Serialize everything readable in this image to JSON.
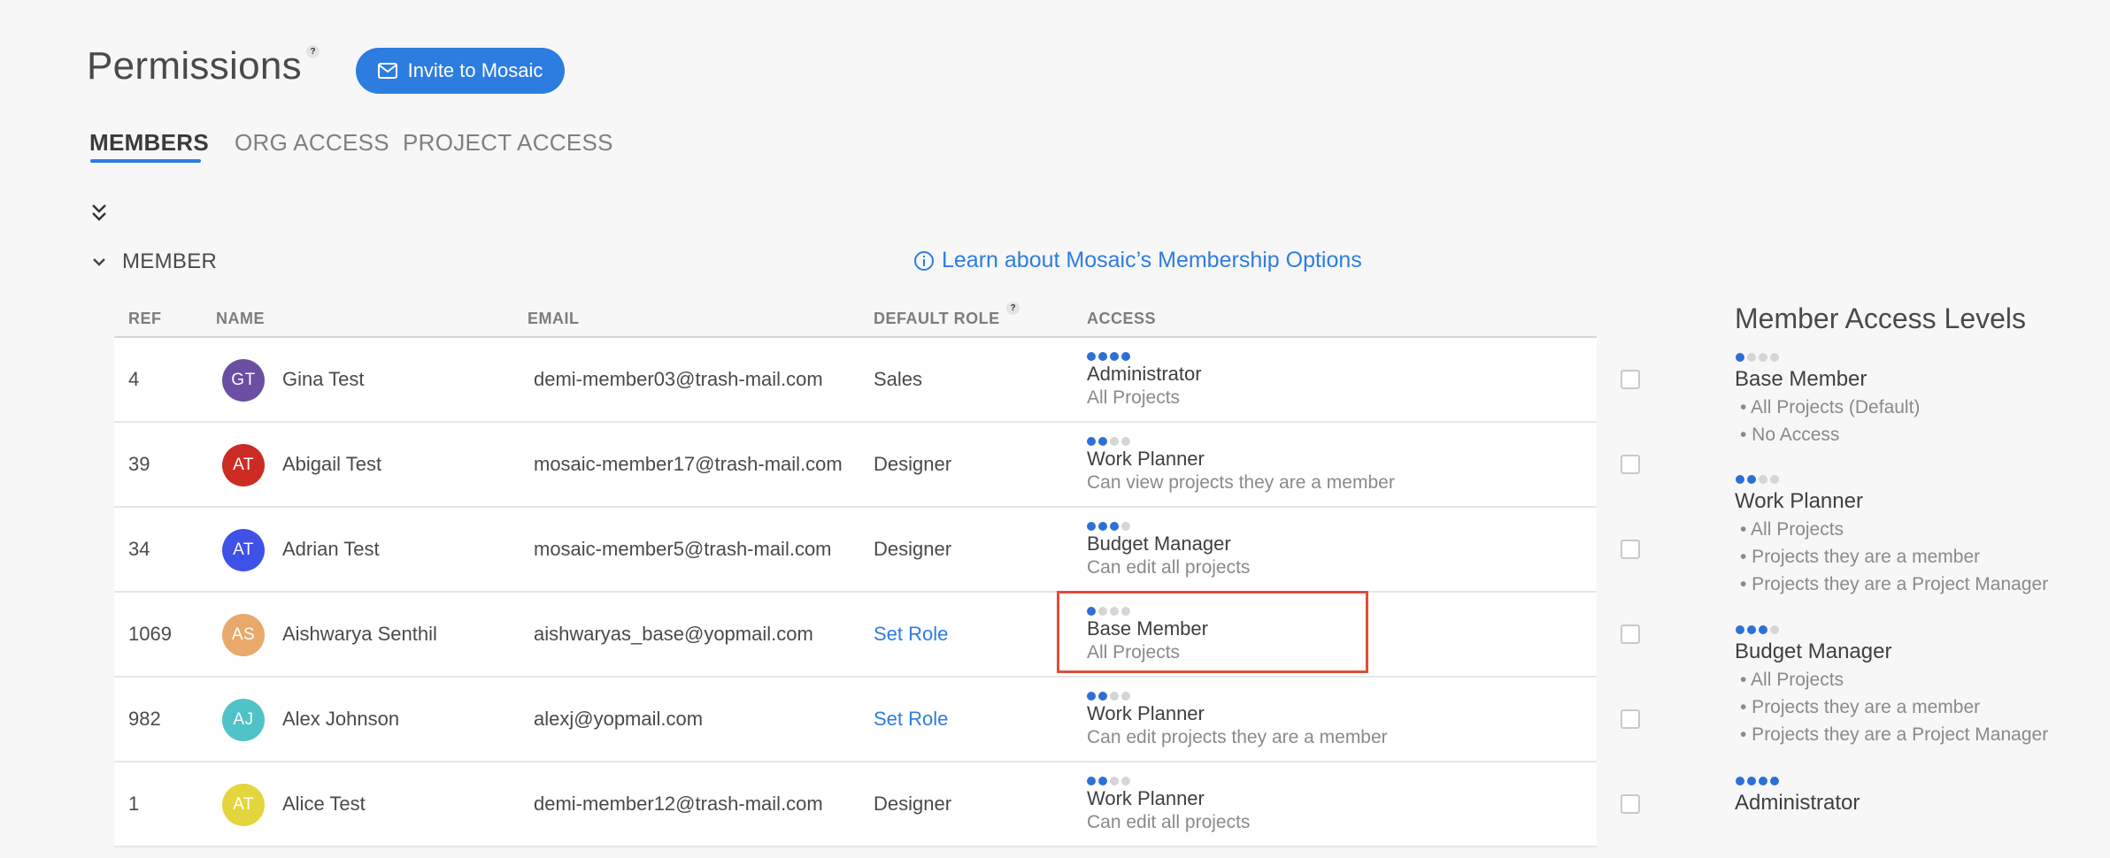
{
  "header": {
    "title": "Permissions",
    "help_symbol": "?",
    "invite_label": "Invite to Mosaic"
  },
  "tabs": [
    {
      "label": "MEMBERS",
      "active": true
    },
    {
      "label": "ORG ACCESS",
      "active": false
    },
    {
      "label": "PROJECT ACCESS",
      "active": false
    }
  ],
  "section": {
    "title": "MEMBER",
    "learn_link": "Learn about Mosaic’s Membership Options"
  },
  "table": {
    "columns": [
      "REF",
      "NAME",
      "EMAIL",
      "DEFAULT ROLE",
      "ACCESS"
    ],
    "rows": [
      {
        "ref": "4",
        "initials": "GT",
        "avatar_color": "#6a4fa3",
        "name": "Gina Test",
        "email": "demi-member03@trash-mail.com",
        "role": "Sales",
        "role_is_link": false,
        "level": 4,
        "access": "Administrator",
        "access_sub": "All Projects"
      },
      {
        "ref": "39",
        "initials": "AT",
        "avatar_color": "#cc2b24",
        "name": "Abigail Test",
        "email": "mosaic-member17@trash-mail.com",
        "role": "Designer",
        "role_is_link": false,
        "level": 2,
        "access": "Work Planner",
        "access_sub": "Can view projects they are a member"
      },
      {
        "ref": "34",
        "initials": "AT",
        "avatar_color": "#3f51e6",
        "name": "Adrian Test",
        "email": "mosaic-member5@trash-mail.com",
        "role": "Designer",
        "role_is_link": false,
        "level": 3,
        "access": "Budget Manager",
        "access_sub": "Can edit all projects"
      },
      {
        "ref": "1069",
        "initials": "AS",
        "avatar_color": "#e8a96b",
        "name": "Aishwarya Senthil",
        "email": "aishwaryas_base@yopmail.com",
        "role": "Set Role",
        "role_is_link": true,
        "level": 1,
        "access": "Base Member",
        "access_sub": "All Projects"
      },
      {
        "ref": "982",
        "initials": "AJ",
        "avatar_color": "#4fc3c7",
        "name": "Alex Johnson",
        "email": "alexj@yopmail.com",
        "role": "Set Role",
        "role_is_link": true,
        "level": 2,
        "access": "Work Planner",
        "access_sub": "Can edit projects they are a member"
      },
      {
        "ref": "1",
        "initials": "AT",
        "avatar_color": "#e3d63c",
        "name": "Alice Test",
        "email": "demi-member12@trash-mail.com",
        "role": "Designer",
        "role_is_link": false,
        "level": 2,
        "access": "Work Planner",
        "access_sub": "Can edit all projects"
      }
    ]
  },
  "sidebar": {
    "title": "Member Access Levels",
    "levels": [
      {
        "name": "Base Member",
        "level": 1,
        "items": [
          "• All Projects (Default)",
          "• No Access"
        ]
      },
      {
        "name": "Work Planner",
        "level": 2,
        "items": [
          "• All Projects",
          "• Projects they are a member",
          "• Projects they are a Project Manager"
        ]
      },
      {
        "name": "Budget Manager",
        "level": 3,
        "items": [
          "• All Projects",
          "• Projects they are a member",
          "• Projects they are a Project Manager"
        ]
      },
      {
        "name": "Administrator",
        "level": 4,
        "items": []
      }
    ]
  },
  "colors": {
    "accent": "#2d7de0",
    "dot_on": "#2d6fd6",
    "dot_off": "#d5d5d5",
    "highlight": "#e04d38"
  }
}
